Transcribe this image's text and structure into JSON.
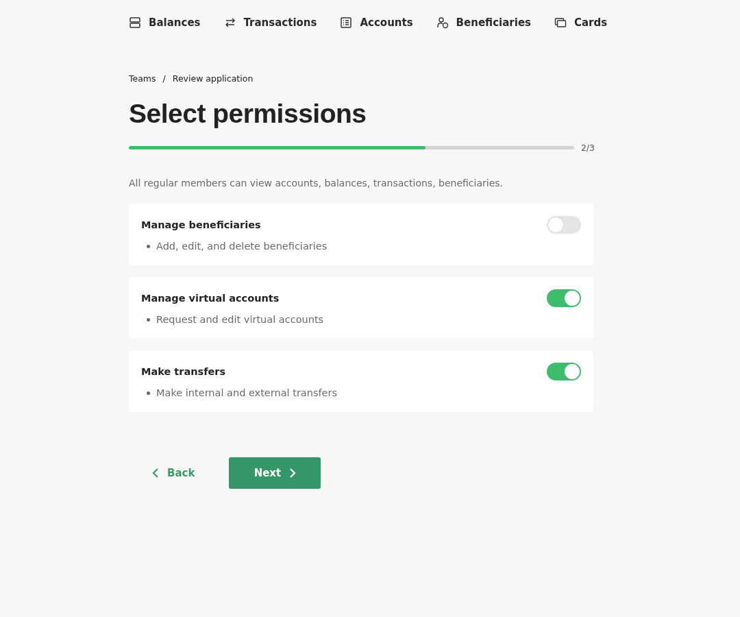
{
  "nav": [
    {
      "kind": "balances",
      "label": "Balances"
    },
    {
      "kind": "transactions",
      "label": "Transactions"
    },
    {
      "kind": "accounts",
      "label": "Accounts"
    },
    {
      "kind": "beneficiaries",
      "label": "Beneficiaries"
    },
    {
      "kind": "cards",
      "label": "Cards"
    }
  ],
  "breadcrumb": [
    "Teams",
    "/",
    "Review application"
  ],
  "title": "Select permissions",
  "progress": {
    "level": 0.667,
    "reading": "2/3"
  },
  "intro": "All regular members can view accounts, balances, transactions, beneficiaries.",
  "permissions": [
    {
      "name": "Manage beneficiaries",
      "detail": "Add, edit, and delete beneficiaries",
      "on": false
    },
    {
      "name": "Manage virtual accounts",
      "detail": "Request and edit virtual accounts",
      "on": true
    },
    {
      "name": "Make transfers",
      "detail": "Make internal and external transfers",
      "on": true
    }
  ],
  "back": "Back",
  "next": "Next"
}
